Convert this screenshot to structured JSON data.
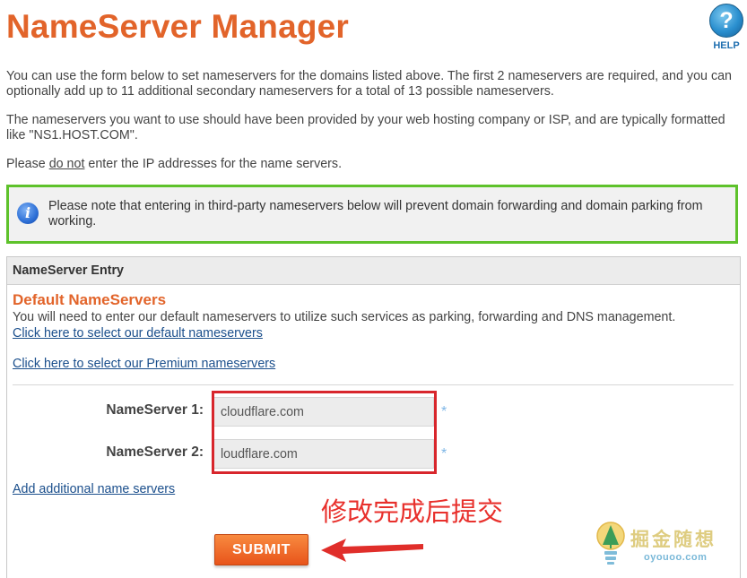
{
  "header": {
    "title": "NameServer Manager",
    "help_label": "HELP",
    "help_icon": "question-mark-icon"
  },
  "intro": {
    "p1": "You can use the form below to set nameservers for the domains listed above. The first 2 nameservers are required, and you can optionally add up to 11 additional secondary nameservers for a total of 13 possible nameservers.",
    "p2": "The nameservers you want to use should have been provided by your web hosting company or ISP, and are typically formatted like \"NS1.HOST.COM\".",
    "p3_before": "Please ",
    "p3_underlined": "do not",
    "p3_after": " enter the IP addresses for the name servers."
  },
  "notice": {
    "icon": "info-icon",
    "text": "Please note that entering in third-party nameservers below will prevent domain forwarding and domain parking from working.",
    "border_color": "#5ec22b"
  },
  "panel": {
    "header": "NameServer Entry",
    "section_title": "Default NameServers",
    "section_desc": "You will need to enter our default nameservers to utilize such services as parking, forwarding and DNS management.",
    "default_link": "Click here to select our default nameservers",
    "premium_link": "Click here to select our Premium nameservers",
    "add_link": "Add additional name servers",
    "nameservers": [
      {
        "label": "NameServer 1:",
        "value": "cloudflare.com",
        "required_mark": "*"
      },
      {
        "label": "NameServer 2:",
        "value": "loudflare.com",
        "required_mark": "*"
      }
    ],
    "submit_label": "SUBMIT"
  },
  "annotation": {
    "text": "修改完成后提交",
    "color": "#e8302c"
  },
  "watermark": {
    "text": "掘金随想",
    "sub": "oyouoo.com"
  },
  "colors": {
    "accent": "#e2642a",
    "link": "#1b4f8c",
    "highlight_box": "#d8262c"
  }
}
